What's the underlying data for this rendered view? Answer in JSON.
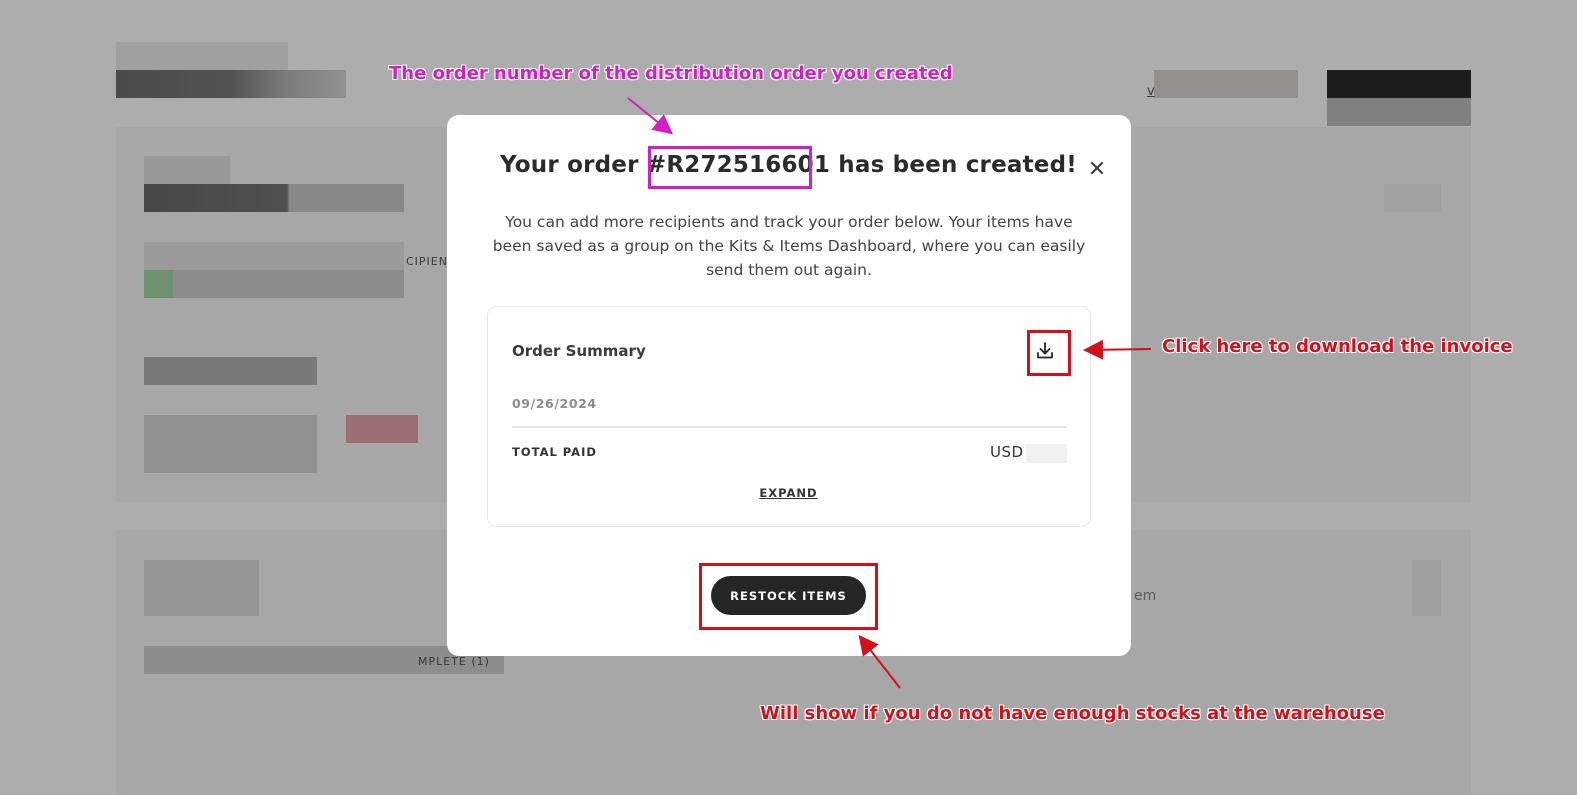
{
  "modal": {
    "title_prefix": "Your order ",
    "order_number": "#R272516601",
    "title_suffix": " has been created!",
    "description": "You can add more recipients and track your order below. Your items have been saved as a group on the Kits & Items Dashboard, where you can easily send them out again.",
    "order_summary": {
      "label": "Order Summary",
      "download_icon": "download-icon",
      "date": "09/26/2024",
      "total_paid_label": "TOTAL PAID",
      "currency": "USD",
      "expand_label": "EXPAND"
    },
    "restock_button": "RESTOCK ITEMS",
    "close_icon": "close-icon"
  },
  "background": {
    "partial_text_1": "CIPIEN",
    "partial_text_2": "MPLETE (1)",
    "partial_text_3": "em",
    "partial_text_4": "v"
  },
  "annotations": {
    "order_number_note": "The order number of the distribution order  you created",
    "download_note": "Click here to download the invoice",
    "restock_note": "Will show if you do not have enough stocks at the warehouse"
  },
  "colors": {
    "annotation_magenta": "#d31ec4",
    "annotation_red": "#d40f19",
    "button_dark": "#262626"
  }
}
